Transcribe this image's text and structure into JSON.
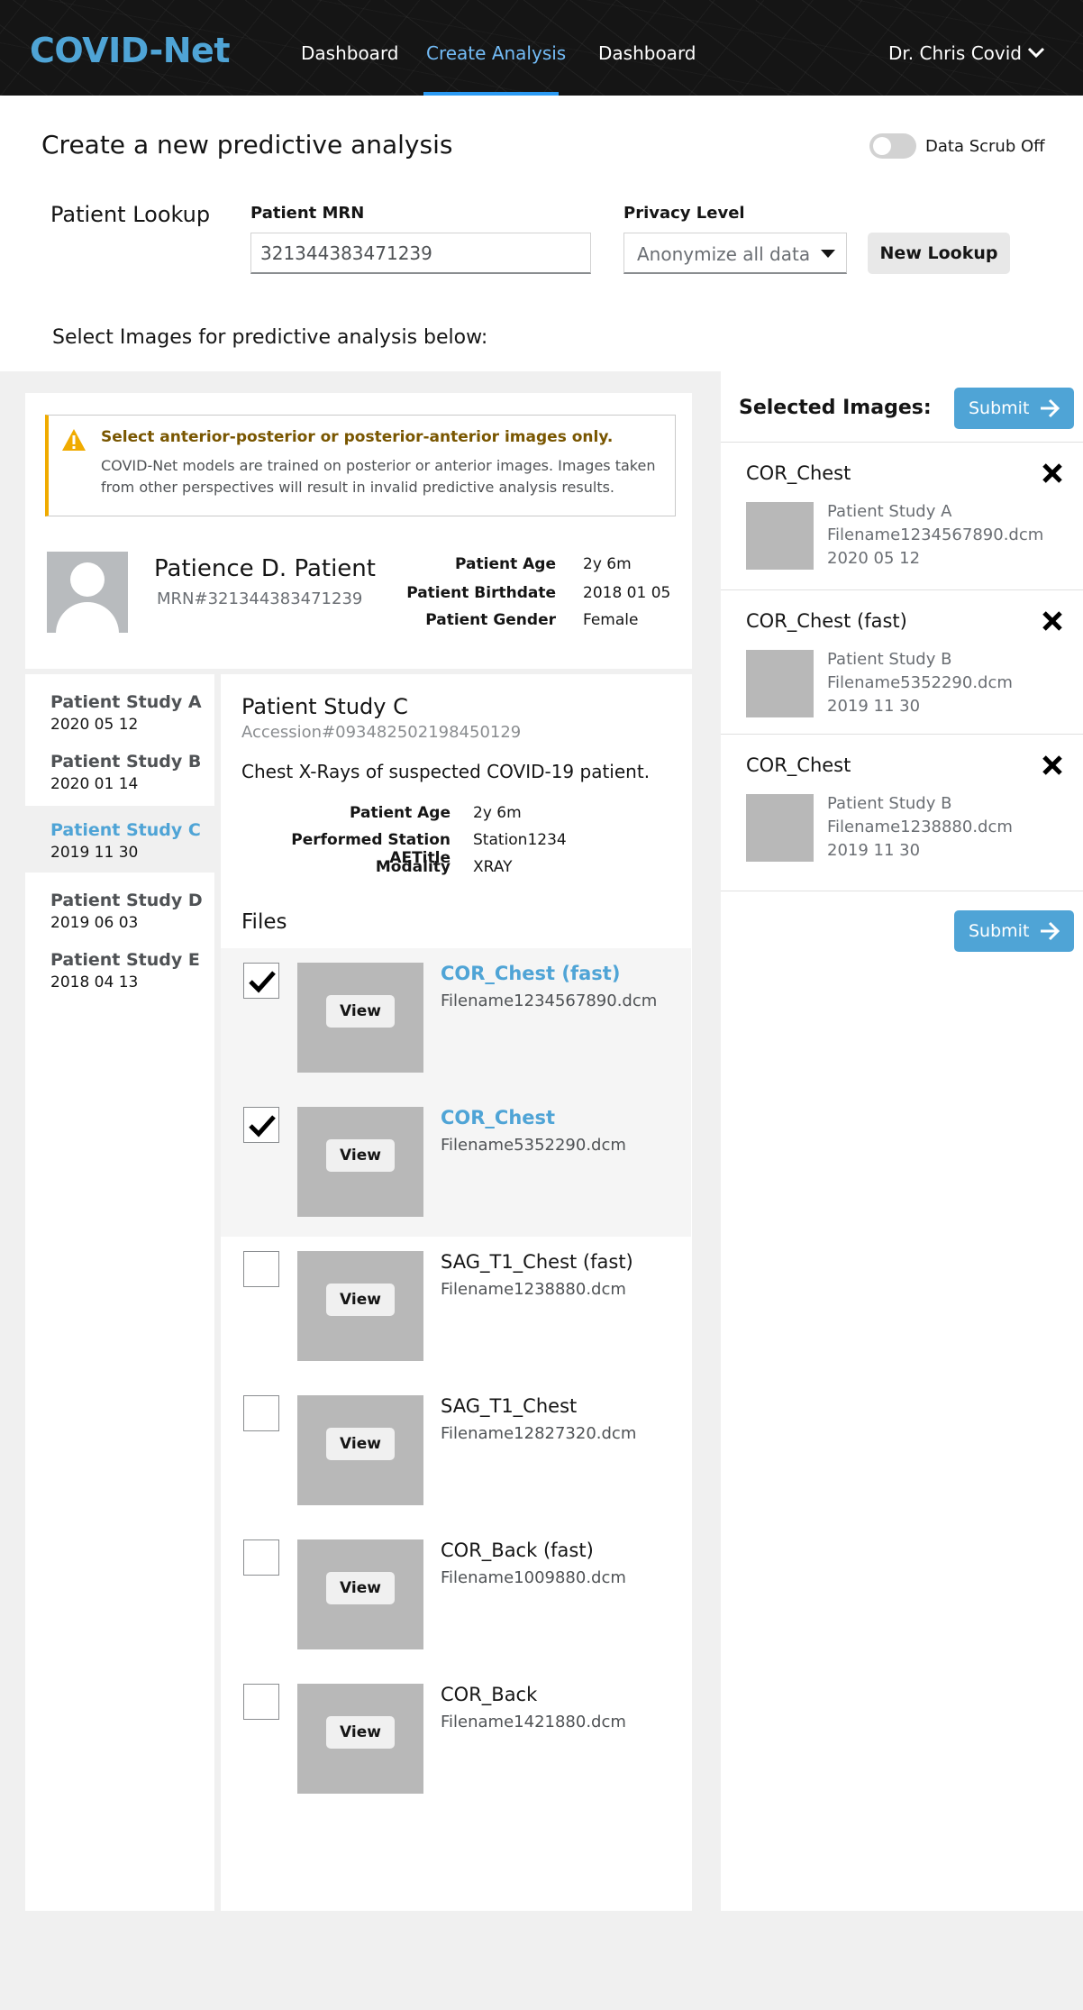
{
  "header": {
    "logo": "COVID-Net",
    "nav": [
      {
        "label": "Dashboard"
      },
      {
        "label": "Create Analysis"
      },
      {
        "label": "Dashboard"
      }
    ],
    "user": "Dr. Chris Covid"
  },
  "lookup": {
    "page_title": "Create a new predictive analysis",
    "scrub_label": "Data Scrub Off",
    "section_title": "Patient Lookup",
    "mrn_label": "Patient MRN",
    "mrn_value": "321344383471239",
    "privacy_label": "Privacy Level",
    "privacy_value": "Anonymize all data",
    "new_lookup_label": "New Lookup",
    "instructions": "Select Images for predictive analysis below:"
  },
  "alert": {
    "title": "Select anterior-posterior or posterior-anterior images only.",
    "body": "COVID-Net models are trained on posterior or anterior images. Images taken from other perspectives will result in invalid predictive analysis results."
  },
  "patient": {
    "name": "Patience D. Patient",
    "mrn": "MRN#321344383471239",
    "info": [
      {
        "label": "Patient Age",
        "value": "2y 6m"
      },
      {
        "label": "Patient Birthdate",
        "value": "2018 01 05"
      },
      {
        "label": "Patient Gender",
        "value": "Female"
      }
    ]
  },
  "studies": [
    {
      "name": "Patient Study A",
      "date": "2020 05 12"
    },
    {
      "name": "Patient Study B",
      "date": "2020 01 14"
    },
    {
      "name": "Patient Study C",
      "date": "2019 11 30"
    },
    {
      "name": "Patient Study D",
      "date": "2019 06 03"
    },
    {
      "name": "Patient Study E",
      "date": "2018 04 13"
    }
  ],
  "study_detail": {
    "title": "Patient Study C",
    "accession": "Accession#093482502198450129",
    "description": "Chest X-Rays of suspected COVID-19 patient.",
    "info": [
      {
        "label": "Patient Age",
        "value": "2y 6m"
      },
      {
        "label": "Performed Station AETitle",
        "value": "Station1234"
      },
      {
        "label": "Modality",
        "value": "XRAY"
      }
    ],
    "files_title": "Files",
    "view_label": "View",
    "files": [
      {
        "name": "COR_Chest (fast)",
        "filename": "Filename1234567890.dcm",
        "selected": true
      },
      {
        "name": "COR_Chest",
        "filename": "Filename5352290.dcm",
        "selected": true
      },
      {
        "name": "SAG_T1_Chest (fast)",
        "filename": "Filename1238880.dcm",
        "selected": false
      },
      {
        "name": "SAG_T1_Chest",
        "filename": "Filename12827320.dcm",
        "selected": false
      },
      {
        "name": "COR_Back (fast)",
        "filename": "Filename1009880.dcm",
        "selected": false
      },
      {
        "name": "COR_Back",
        "filename": "Filename1421880.dcm",
        "selected": false
      }
    ]
  },
  "selected": {
    "title": "Selected Images:",
    "submit_label": "Submit",
    "items": [
      {
        "name": "COR_Chest",
        "study": "Patient Study A",
        "filename": "Filename1234567890.dcm",
        "date": "2020 05 12"
      },
      {
        "name": "COR_Chest (fast)",
        "study": "Patient Study B",
        "filename": "Filename5352290.dcm",
        "date": "2019 11 30"
      },
      {
        "name": "COR_Chest",
        "study": "Patient Study B",
        "filename": "Filename1238880.dcm",
        "date": "2019 11 30"
      }
    ]
  },
  "colors": {
    "brand": "#4fa4d6",
    "nav_active": "#73bcf7",
    "warning": "#f0ab00"
  }
}
